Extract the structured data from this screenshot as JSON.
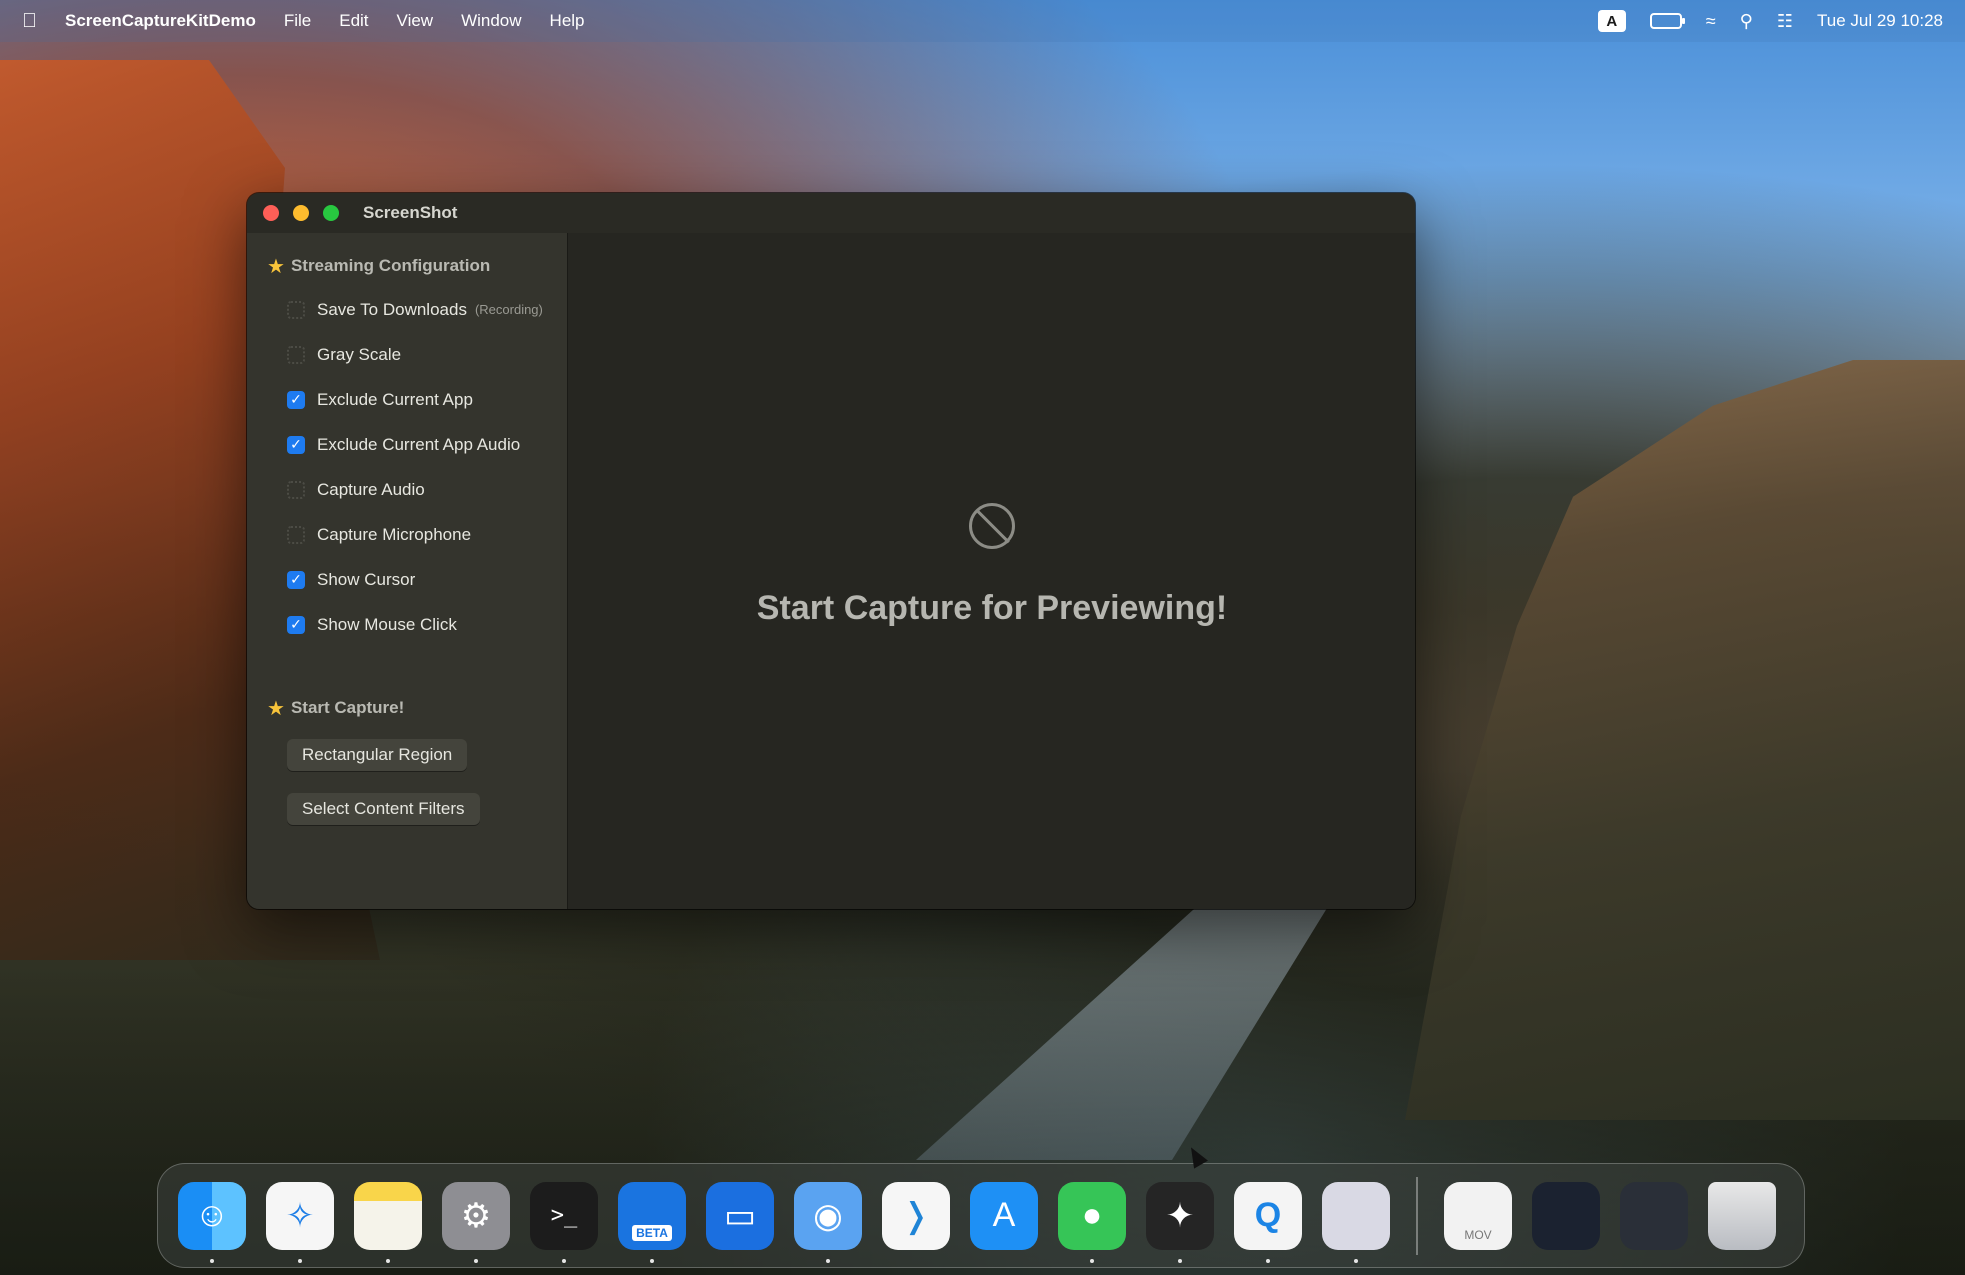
{
  "menubar": {
    "app_name": "ScreenCaptureKitDemo",
    "items": [
      "File",
      "Edit",
      "View",
      "Window",
      "Help"
    ],
    "input_source": "A",
    "clock": "Tue Jul 29  10:28"
  },
  "window": {
    "title": "ScreenShot",
    "sidebar": {
      "config_header": "Streaming Configuration",
      "options": [
        {
          "label": "Save To Downloads",
          "hint": "(Recording)",
          "checked": false
        },
        {
          "label": "Gray Scale",
          "hint": "",
          "checked": false
        },
        {
          "label": "Exclude Current App",
          "hint": "",
          "checked": true
        },
        {
          "label": "Exclude Current App Audio",
          "hint": "",
          "checked": true
        },
        {
          "label": "Capture Audio",
          "hint": "",
          "checked": false
        },
        {
          "label": "Capture Microphone",
          "hint": "",
          "checked": false
        },
        {
          "label": "Show Cursor",
          "hint": "",
          "checked": true
        },
        {
          "label": "Show Mouse Click",
          "hint": "",
          "checked": true
        }
      ],
      "capture_header": "Start Capture!",
      "buttons": [
        "Rectangular Region",
        "Select Content Filters"
      ]
    },
    "preview_message": "Start Capture for Previewing!"
  },
  "dock": {
    "beta_badge": "BETA",
    "mov_label": "MOV"
  }
}
